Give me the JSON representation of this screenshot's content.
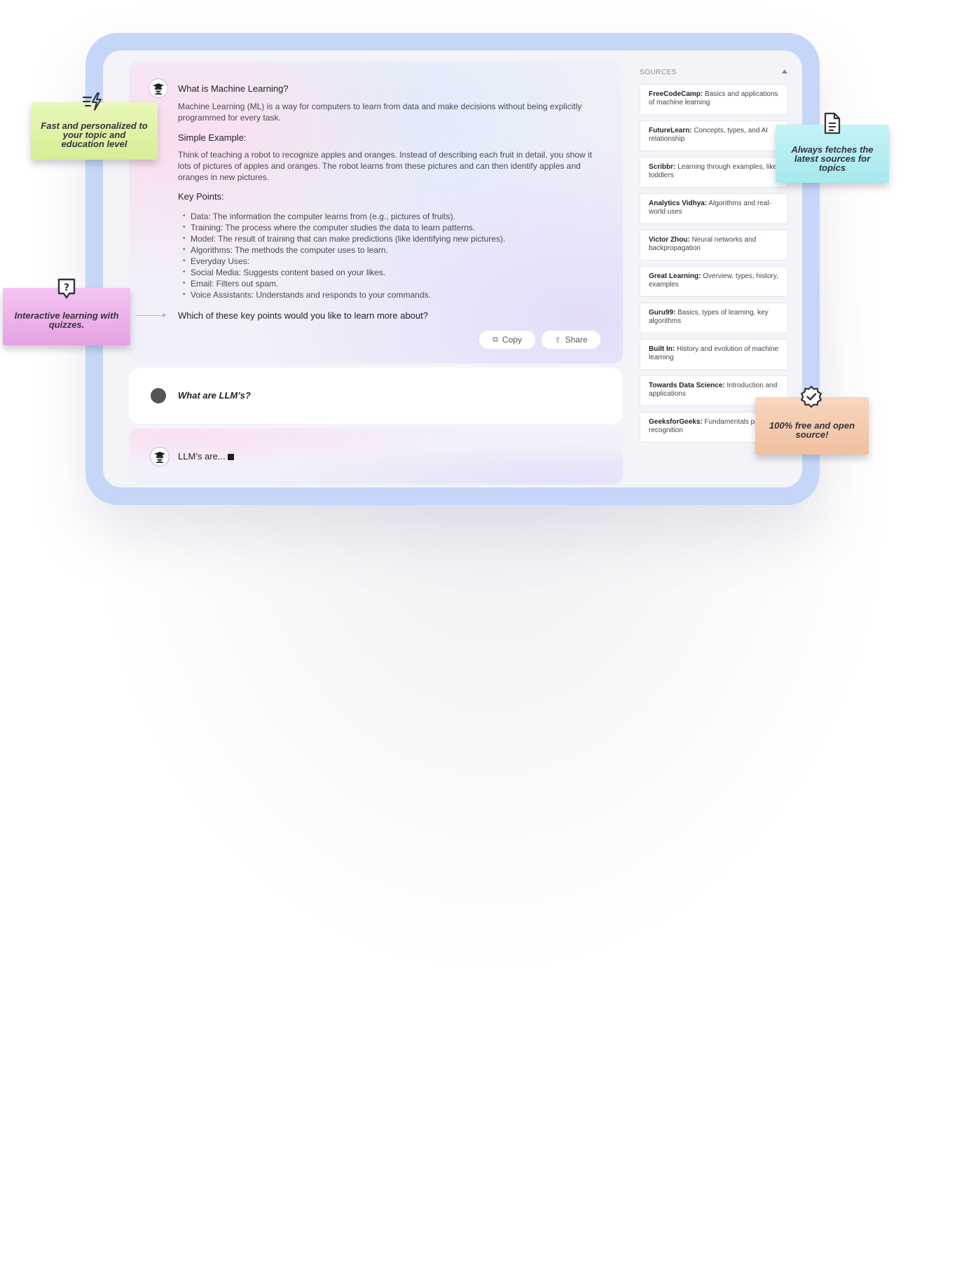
{
  "answer": {
    "question": "What is Machine Learning?",
    "intro": "Machine Learning (ML) is a way for computers to learn from data and make decisions without being explicitly programmed for every task.",
    "simple_example_heading": "Simple Example:",
    "simple_example": "Think of teaching a robot to recognize apples and oranges. Instead of describing each fruit in detail, you show it lots of pictures of apples and oranges. The robot learns from these pictures and can then identify apples and oranges in new pictures.",
    "key_points_heading": "Key Points:",
    "key_points": [
      "Data: The information the computer learns from (e.g., pictures of fruits).",
      "Training: The process where the computer studies the data to learn patterns.",
      "Model: The result of training that can make predictions (like identifying new pictures).",
      "Algorithms: The methods the computer uses to learn.",
      "Everyday Uses:",
      "Social Media: Suggests content based on your likes.",
      "Email: Filters out spam.",
      "Voice Assistants: Understands and responds to your commands."
    ],
    "follow_up": "Which of these key points would you like to learn more about?",
    "copy_label": "Copy",
    "share_label": "Share"
  },
  "user_message": "What are LLM’s?",
  "streaming": {
    "text": "LLM’s are..."
  },
  "sources": {
    "heading": "SOURCES",
    "items": [
      {
        "name": "FreeCodeCamp:",
        "desc": "Basics and applications of machine learning"
      },
      {
        "name": "FutureLearn:",
        "desc": "Concepts, types, and AI relationship"
      },
      {
        "name": "Scribbr:",
        "desc": "Learning through examples, like toddlers"
      },
      {
        "name": "Analytics Vidhya:",
        "desc": "Algorithms and real-world uses"
      },
      {
        "name": "Victor Zhou:",
        "desc": "Neural networks and backpropagation"
      },
      {
        "name": "Great Learning:",
        "desc": "Overview, types, history, examples"
      },
      {
        "name": "Guru99:",
        "desc": "Basics, types of learning, key algorithms"
      },
      {
        "name": "Built In:",
        "desc": "History and evolution of machine learning"
      },
      {
        "name": "Towards Data Science:",
        "desc": "Introduction and applications"
      },
      {
        "name": "GeeksforGeeks:",
        "desc": "Fundamentals pattern recognition"
      }
    ]
  },
  "callouts": {
    "fast": {
      "text": "Fast and personalized to your topic and education level",
      "icon": "lightning-speed-icon",
      "color": "#dcf2a0"
    },
    "sources": {
      "text": "Always fetches the latest sources for topics",
      "icon": "document-icon",
      "color": "#b6eef2"
    },
    "quiz": {
      "text": "Interactive learning with quizzes.",
      "icon": "question-bubble-icon",
      "color": "#f0b8ee"
    },
    "free": {
      "text": "100% free and open source!",
      "icon": "verified-badge-icon",
      "color": "#f6cdb0"
    }
  },
  "colors": {
    "frame": "#c5d6f8",
    "arrow": "#e69ae6"
  }
}
